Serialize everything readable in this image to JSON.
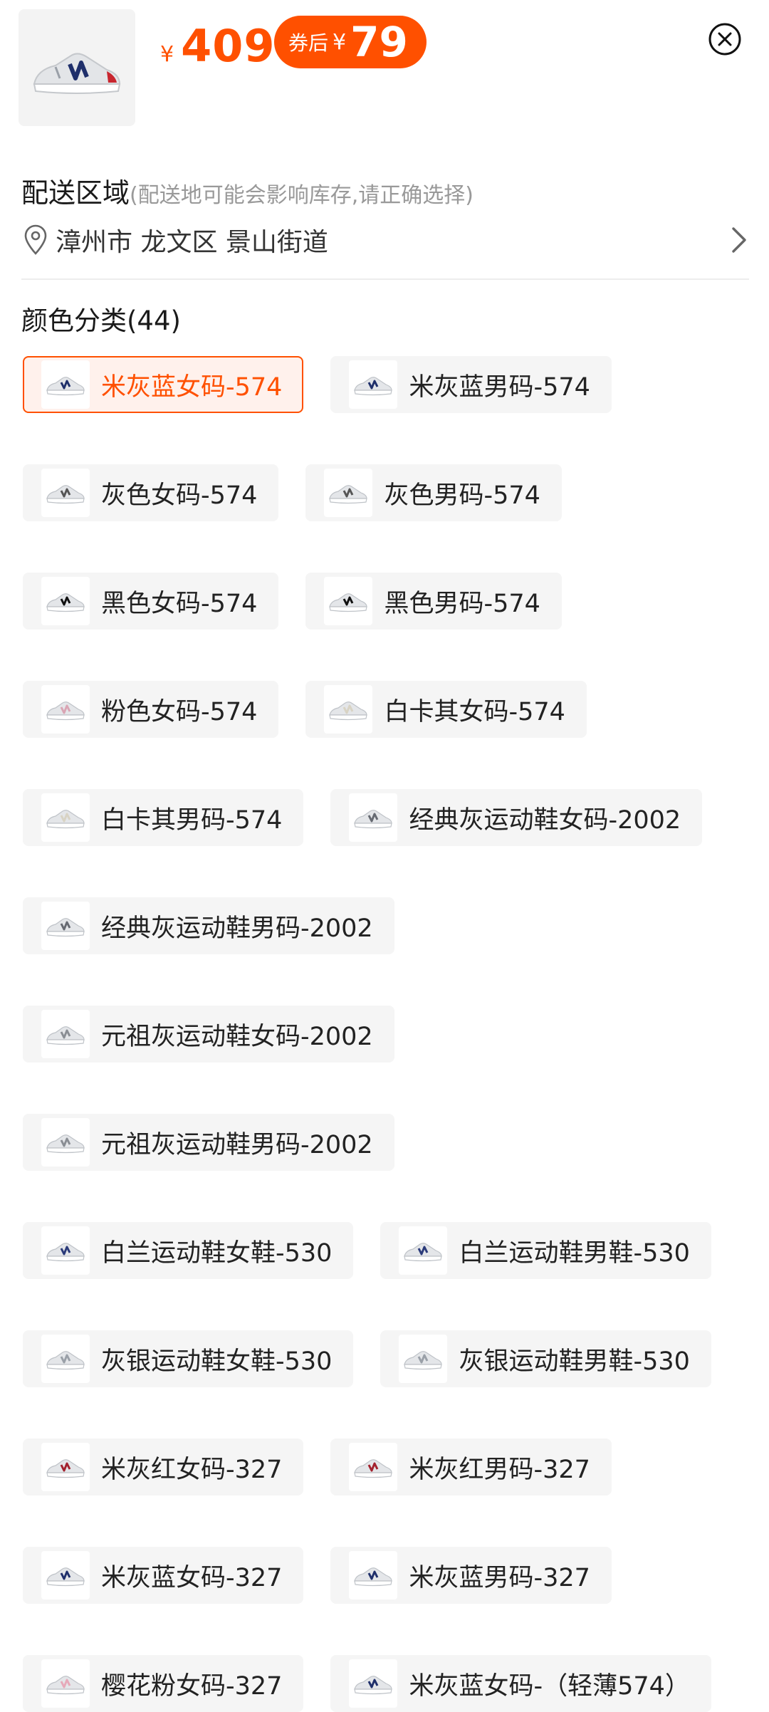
{
  "header": {
    "price_symbol": "¥",
    "price": "409",
    "coupon_label": "券后",
    "coupon_symbol": "¥",
    "coupon_price": "79"
  },
  "delivery": {
    "title": "配送区域",
    "hint": "(配送地可能会影响库存,请正确选择)",
    "address": "漳州市 龙文区 景山街道"
  },
  "color": {
    "title": "颜色分类(44)",
    "options": [
      {
        "label": "米灰蓝女码-574",
        "selected": true,
        "accent": "#1f2f6b"
      },
      {
        "label": "米灰蓝男码-574",
        "selected": false,
        "accent": "#1f2f6b"
      },
      {
        "label": "灰色女码-574",
        "selected": false,
        "accent": "#555555"
      },
      {
        "label": "灰色男码-574",
        "selected": false,
        "accent": "#555555"
      },
      {
        "label": "黑色女码-574",
        "selected": false,
        "accent": "#111111"
      },
      {
        "label": "黑色男码-574",
        "selected": false,
        "accent": "#111111"
      },
      {
        "label": "粉色女码-574",
        "selected": false,
        "accent": "#d9a5b4"
      },
      {
        "label": "白卡其女码-574",
        "selected": false,
        "accent": "#d8d3c4"
      },
      {
        "label": "白卡其男码-574",
        "selected": false,
        "accent": "#d8d3c4"
      },
      {
        "label": "经典灰运动鞋女码-2002",
        "selected": false,
        "accent": "#666a72"
      },
      {
        "label": "经典灰运动鞋男码-2002",
        "selected": false,
        "accent": "#666a72"
      },
      {
        "label": "元祖灰运动鞋女码-2002",
        "selected": false,
        "accent": "#8a8e94"
      },
      {
        "label": "元祖灰运动鞋男码-2002",
        "selected": false,
        "accent": "#8a8e94"
      },
      {
        "label": "白兰运动鞋女鞋-530",
        "selected": false,
        "accent": "#2b3b7a"
      },
      {
        "label": "白兰运动鞋男鞋-530",
        "selected": false,
        "accent": "#2b3b7a"
      },
      {
        "label": "灰银运动鞋女鞋-530",
        "selected": false,
        "accent": "#9aa0a8"
      },
      {
        "label": "灰银运动鞋男鞋-530",
        "selected": false,
        "accent": "#9aa0a8"
      },
      {
        "label": "米灰红女码-327",
        "selected": false,
        "accent": "#a3222e"
      },
      {
        "label": "米灰红男码-327",
        "selected": false,
        "accent": "#a3222e"
      },
      {
        "label": "米灰蓝女码-327",
        "selected": false,
        "accent": "#1f2f6b"
      },
      {
        "label": "米灰蓝男码-327",
        "selected": false,
        "accent": "#1f2f6b"
      },
      {
        "label": "樱花粉女码-327",
        "selected": false,
        "accent": "#e6a9b9"
      },
      {
        "label": "米灰蓝女码-（轻薄574）",
        "selected": false,
        "accent": "#1f2f6b"
      }
    ]
  },
  "colors": {
    "accent": "#ff5000",
    "selected_bg": "#fff1ec",
    "option_bg": "#f5f5f5"
  }
}
